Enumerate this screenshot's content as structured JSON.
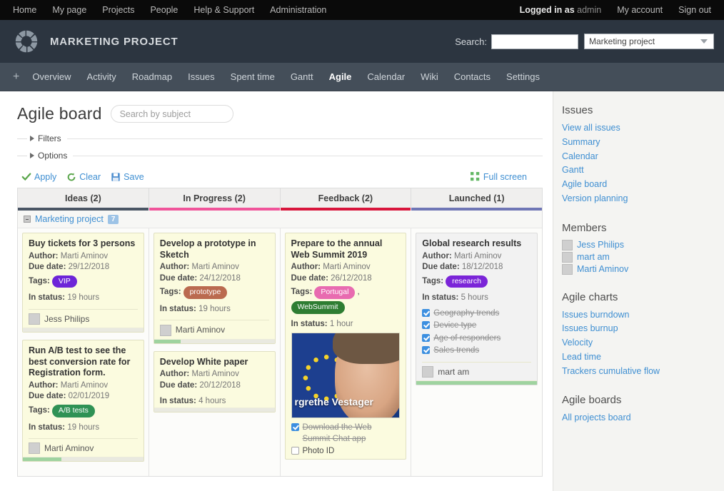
{
  "topbar": {
    "links": [
      "Home",
      "My page",
      "Projects",
      "People",
      "Help & Support",
      "Administration"
    ],
    "logged_in_prefix": "Logged in as",
    "logged_in_user": "admin",
    "my_account": "My account",
    "sign_out": "Sign out"
  },
  "header": {
    "project_title": "MARKETING PROJECT",
    "search_label": "Search:",
    "search_value": "",
    "search_placeholder": "",
    "project_select_value": "Marketing project"
  },
  "nav": {
    "plus": "+",
    "items": [
      {
        "label": "Overview",
        "active": false
      },
      {
        "label": "Activity",
        "active": false
      },
      {
        "label": "Roadmap",
        "active": false
      },
      {
        "label": "Issues",
        "active": false
      },
      {
        "label": "Spent time",
        "active": false
      },
      {
        "label": "Gantt",
        "active": false
      },
      {
        "label": "Agile",
        "active": true
      },
      {
        "label": "Calendar",
        "active": false
      },
      {
        "label": "Wiki",
        "active": false
      },
      {
        "label": "Contacts",
        "active": false
      },
      {
        "label": "Settings",
        "active": false
      }
    ]
  },
  "page": {
    "title": "Agile board",
    "subject_search_placeholder": "Search by subject",
    "subject_search_value": "",
    "filters_label": "Filters",
    "options_label": "Options",
    "apply_label": "Apply",
    "clear_label": "Clear",
    "save_label": "Save",
    "fullscreen_label": "Full screen"
  },
  "board": {
    "columns": [
      {
        "name": "Ideas (2)",
        "color": "#4a5564"
      },
      {
        "name": "In Progress (2)",
        "color": "#f0549a"
      },
      {
        "name": "Feedback (2)",
        "color": "#d8153c"
      },
      {
        "name": "Launched (1)",
        "color": "#6f76b5"
      }
    ],
    "swimlane": {
      "name": "Marketing project",
      "count": "7"
    },
    "cards": [
      [
        {
          "title": "Buy tickets for 3 persons",
          "author_label": "Author:",
          "author": "Marti Aminov",
          "due_label": "Due date:",
          "due": "29/12/2018",
          "tags_label": "Tags:",
          "tags": [
            {
              "name": "VIP",
              "color": "#6d25d8"
            }
          ],
          "status_label": "In status:",
          "status": "19 hours",
          "assignee": "Jess Philips",
          "progress": 0,
          "checklist": []
        },
        {
          "title": "Run A/B test to see the best conversion rate for Registration form.",
          "author_label": "Author:",
          "author": "Marti Aminov",
          "due_label": "Due date:",
          "due": "02/01/2019",
          "tags_label": "Tags:",
          "tags": [
            {
              "name": "A/B tests",
              "color": "#2f9255"
            }
          ],
          "status_label": "In status:",
          "status": "19 hours",
          "assignee": "Marti Aminov",
          "progress": 32,
          "checklist": []
        }
      ],
      [
        {
          "title": "Develop a prototype in Sketch",
          "author_label": "Author:",
          "author": "Marti Aminov",
          "due_label": "Due date:",
          "due": "24/12/2018",
          "tags_label": "Tags:",
          "tags": [
            {
              "name": "prototype",
              "color": "#ba6a4f"
            }
          ],
          "status_label": "In status:",
          "status": "19 hours",
          "assignee": "Marti Aminov",
          "progress": 22,
          "checklist": []
        },
        {
          "title": "Develop White paper",
          "author_label": "Author:",
          "author": "Marti Aminov",
          "due_label": "Due date:",
          "due": "20/12/2018",
          "tags_label": "",
          "tags": [],
          "status_label": "In status:",
          "status": "4 hours",
          "assignee": "",
          "progress": 0,
          "checklist": []
        }
      ],
      [
        {
          "title": "Prepare to the annual Web Summit 2019",
          "author_label": "Author:",
          "author": "Marti Aminov",
          "due_label": "Due date:",
          "due": "26/12/2018",
          "tags_label": "Tags:",
          "tags": [
            {
              "name": "Portugal",
              "color": "#e86bb0"
            },
            {
              "name": "WebSummit",
              "color": "#2e7d32"
            }
          ],
          "status_label": "In status:",
          "status": "1 hour",
          "assignee": "",
          "progress": -1,
          "image_caption": "rgrethe Vestager",
          "checklist": [
            {
              "label": "Download the Web Summit Chat app",
              "checked": true
            },
            {
              "label": "Photo ID",
              "checked": false
            }
          ]
        }
      ],
      [
        {
          "title": "Global research results",
          "grey": true,
          "author_label": "Author:",
          "author": "Marti Aminov",
          "due_label": "Due date:",
          "due": "18/12/2018",
          "tags_label": "Tags:",
          "tags": [
            {
              "name": "research",
              "color": "#7b25d8"
            }
          ],
          "status_label": "In status:",
          "status": "5 hours",
          "assignee": "mart am",
          "progress": 100,
          "checklist": [
            {
              "label": "Geography trends",
              "checked": true
            },
            {
              "label": "Device type",
              "checked": true
            },
            {
              "label": "Age of responders",
              "checked": true
            },
            {
              "label": "Sales trends",
              "checked": true
            }
          ]
        }
      ]
    ]
  },
  "sidebar": {
    "blocks": [
      {
        "heading": "Issues",
        "type": "links",
        "items": [
          "View all issues",
          "Summary",
          "Calendar",
          "Gantt",
          "Agile board",
          "Version planning"
        ]
      },
      {
        "heading": "Members",
        "type": "members",
        "items": [
          "Jess Philips",
          "mart am",
          "Marti Aminov"
        ]
      },
      {
        "heading": "Agile charts",
        "type": "links",
        "items": [
          "Issues burndown",
          "Issues burnup",
          "Velocity",
          "Lead time",
          "Trackers cumulative flow"
        ]
      },
      {
        "heading": "Agile boards",
        "type": "links",
        "items": [
          "All projects board"
        ]
      }
    ]
  }
}
